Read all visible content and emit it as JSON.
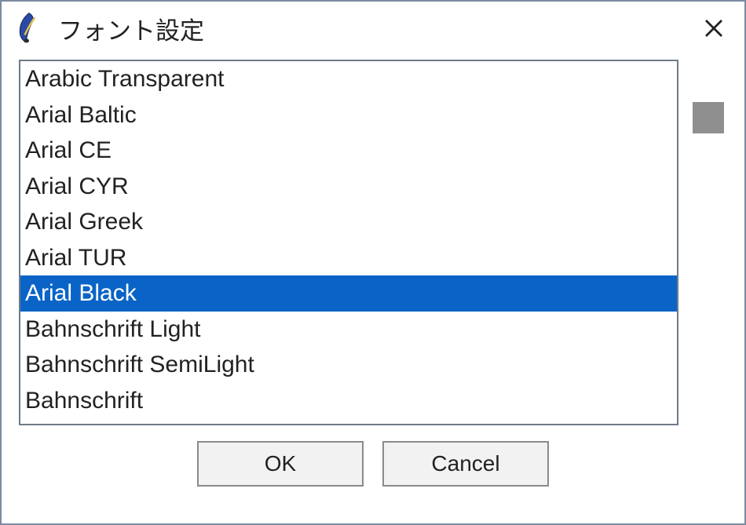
{
  "window": {
    "title": "フォント設定"
  },
  "font_list": {
    "items": [
      "Arabic Transparent",
      "Arial Baltic",
      "Arial CE",
      "Arial CYR",
      "Arial Greek",
      "Arial TUR",
      "Arial Black",
      "Bahnschrift Light",
      "Bahnschrift SemiLight",
      "Bahnschrift"
    ],
    "selected_index": 6
  },
  "buttons": {
    "ok": "OK",
    "cancel": "Cancel"
  }
}
